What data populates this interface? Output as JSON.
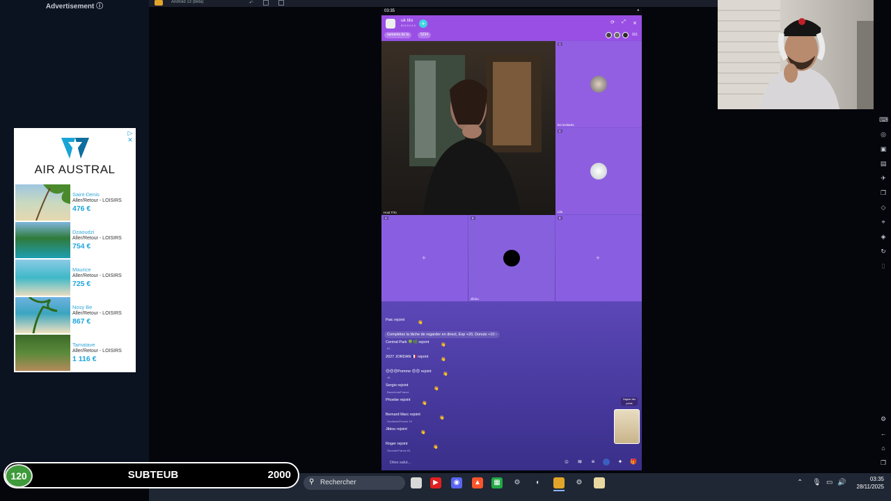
{
  "ad": {
    "header": "Advertisement ⓘ",
    "close": "▷ ✕",
    "brand": "AIR AUSTRAL",
    "offers": [
      {
        "city": "Saint-Denis",
        "desc": "Aller/Retour - LOISIRS",
        "price": "476 €"
      },
      {
        "city": "Dzaoudzi",
        "desc": "Aller/Retour - LOISIRS",
        "price": "754 €"
      },
      {
        "city": "Maurice",
        "desc": "Aller/Retour - LOISIRS",
        "price": "725 €"
      },
      {
        "city": "Nosy Be",
        "desc": "Aller/Retour - LOISIRS",
        "price": "867 €"
      },
      {
        "city": "Tamatave",
        "desc": "Aller/Retour - LOISIRS",
        "price": "1 116 €"
      }
    ]
  },
  "window": {
    "title": "Android 13 (beta)"
  },
  "phone": {
    "time": "03:35",
    "close": "×",
    "room": {
      "name": "uk tito",
      "subtitle": "ID 8 9 4 2 6",
      "chip1": "samemo de la",
      "chip2": "5234",
      "viewers": "161"
    },
    "seats": [
      {
        "label": "Host  TiTo",
        "num": "1"
      },
      {
        "label": "les invitants",
        "num": "1"
      },
      {
        "label": "Lila",
        "num": "2"
      },
      {
        "label": "",
        "num": "4"
      },
      {
        "label": "Jibiou",
        "num": "5"
      },
      {
        "label": "",
        "num": "6"
      }
    ],
    "chat": [
      {
        "text": "Paic rejoint",
        "sub": ""
      },
      {
        "text": "Complétez la tâche de regarder en direct, Exp +20, Donuts +10  ›",
        "sub": ""
      },
      {
        "text": "Central Park 🍀🌿 rejoint",
        "sub": "61"
      },
      {
        "text": "2027 JORDAN 🇫🇷 rejoint",
        "sub": ""
      },
      {
        "text": "😊😊😊Pomme 😊😊 rejoint",
        "sub": "46"
      },
      {
        "text": "Sergio rejoint",
        "sub": "Barcelona/France"
      },
      {
        "text": "Phoebe rejoint",
        "sub": ""
      },
      {
        "text": "Bernard Marc rejoint",
        "sub": "Occitanie/France  19"
      },
      {
        "text": "Jibiou rejoint",
        "sub": ""
      },
      {
        "text": "Roger rejoint",
        "sub": "Gironde/France  63"
      }
    ],
    "input_placeholder": "Dites salut...",
    "gift_badge": "Gagner des points"
  },
  "progress": {
    "count": "120",
    "label": "SUBTEUB",
    "goal": "2000"
  },
  "taskbar": {
    "search_placeholder": "Rechercher",
    "time": "03:35",
    "date": "28/11/2025"
  },
  "colors": {
    "phone_purple": "#8d52e0",
    "header_purple": "#9a4fe4",
    "accent_cyan": "#3fd5e0",
    "progress_green": "#3e9a3a",
    "ad_blue": "#1fa5dc"
  }
}
